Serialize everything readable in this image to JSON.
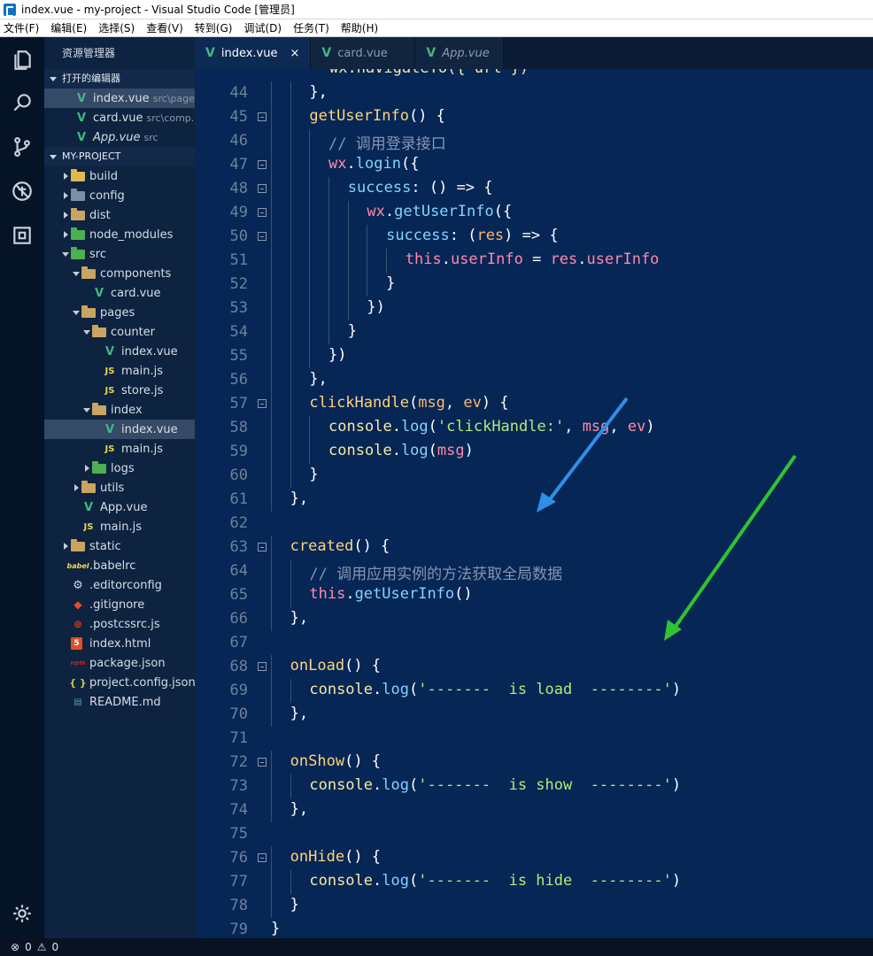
{
  "window": {
    "title": "index.vue - my-project - Visual Studio Code [管理员]"
  },
  "menu": [
    "文件(F)",
    "编辑(E)",
    "选择(S)",
    "查看(V)",
    "转到(G)",
    "调试(D)",
    "任务(T)",
    "帮助(H)"
  ],
  "activity": [
    "explorer-icon",
    "search-icon",
    "source-control-icon",
    "debug-icon",
    "extensions-icon",
    "settings-gear-icon"
  ],
  "sidebar": {
    "header": "资源管理器",
    "open_editors_label": "打开的编辑器",
    "open_editors": [
      {
        "name": "index.vue",
        "path": "src\\page...",
        "icon": "vue"
      },
      {
        "name": "card.vue",
        "path": "src\\comp...",
        "icon": "vue"
      },
      {
        "name": "App.vue",
        "path": "src",
        "icon": "vue"
      }
    ],
    "project_label": "MY-PROJECT",
    "tree": [
      {
        "name": "build",
        "depth": 0,
        "type": "folder",
        "icon": "folder-build",
        "open": false
      },
      {
        "name": "config",
        "depth": 0,
        "type": "folder",
        "icon": "folder-config",
        "open": false
      },
      {
        "name": "dist",
        "depth": 0,
        "type": "folder",
        "icon": "folder",
        "open": false
      },
      {
        "name": "node_modules",
        "depth": 0,
        "type": "folder",
        "icon": "folder-green",
        "open": false
      },
      {
        "name": "src",
        "depth": 0,
        "type": "folder",
        "icon": "folder-green",
        "open": true
      },
      {
        "name": "components",
        "depth": 1,
        "type": "folder",
        "icon": "folder",
        "open": true
      },
      {
        "name": "card.vue",
        "depth": 2,
        "type": "file",
        "icon": "vue"
      },
      {
        "name": "pages",
        "depth": 1,
        "type": "folder",
        "icon": "folder",
        "open": true
      },
      {
        "name": "counter",
        "depth": 2,
        "type": "folder",
        "icon": "folder",
        "open": true
      },
      {
        "name": "index.vue",
        "depth": 3,
        "type": "file",
        "icon": "vue"
      },
      {
        "name": "main.js",
        "depth": 3,
        "type": "file",
        "icon": "js"
      },
      {
        "name": "store.js",
        "depth": 3,
        "type": "file",
        "icon": "js"
      },
      {
        "name": "index",
        "depth": 2,
        "type": "folder",
        "icon": "folder",
        "open": true
      },
      {
        "name": "index.vue",
        "depth": 3,
        "type": "file",
        "icon": "vue",
        "selected": true
      },
      {
        "name": "main.js",
        "depth": 3,
        "type": "file",
        "icon": "js"
      },
      {
        "name": "logs",
        "depth": 2,
        "type": "folder",
        "icon": "folder-green",
        "open": false
      },
      {
        "name": "utils",
        "depth": 1,
        "type": "folder",
        "icon": "folder",
        "open": false
      },
      {
        "name": "App.vue",
        "depth": 1,
        "type": "file",
        "icon": "vue"
      },
      {
        "name": "main.js",
        "depth": 1,
        "type": "file",
        "icon": "js"
      },
      {
        "name": "static",
        "depth": 0,
        "type": "folder",
        "icon": "folder",
        "open": false
      },
      {
        "name": ".babelrc",
        "depth": 0,
        "type": "file",
        "icon": "babel"
      },
      {
        "name": ".editorconfig",
        "depth": 0,
        "type": "file",
        "icon": "gear"
      },
      {
        "name": ".gitignore",
        "depth": 0,
        "type": "file",
        "icon": "git"
      },
      {
        "name": ".postcssrc.js",
        "depth": 0,
        "type": "file",
        "icon": "post"
      },
      {
        "name": "index.html",
        "depth": 0,
        "type": "file",
        "icon": "html5"
      },
      {
        "name": "package.json",
        "depth": 0,
        "type": "file",
        "icon": "npm"
      },
      {
        "name": "project.config.json",
        "depth": 0,
        "type": "file",
        "icon": "json"
      },
      {
        "name": "README.md",
        "depth": 0,
        "type": "file",
        "icon": "md"
      }
    ]
  },
  "tabs": [
    {
      "label": "index.vue",
      "active": true,
      "close": "×"
    },
    {
      "label": "card.vue",
      "active": false
    },
    {
      "label": "App.vue",
      "active": false,
      "italic": true
    }
  ],
  "editor": {
    "partial_top_line": "wx.navigateTo({ url })",
    "lines": [
      {
        "n": 44,
        "indent": 2,
        "tokens": [
          [
            "},",
            "pun"
          ]
        ]
      },
      {
        "n": 45,
        "indent": 2,
        "fold": true,
        "tokens": [
          [
            "getUserInfo",
            "prop"
          ],
          [
            "() {",
            "pun"
          ]
        ]
      },
      {
        "n": 46,
        "indent": 3,
        "tokens": [
          [
            "// 调用登录接口",
            "cmt"
          ]
        ]
      },
      {
        "n": 47,
        "indent": 3,
        "fold": true,
        "tokens": [
          [
            "wx",
            "this"
          ],
          [
            ".",
            "pun"
          ],
          [
            "login",
            "fn"
          ],
          [
            "({",
            "pun"
          ]
        ]
      },
      {
        "n": 48,
        "indent": 4,
        "fold": true,
        "tokens": [
          [
            "success",
            "fn"
          ],
          [
            ": () ",
            "pun"
          ],
          [
            "=>",
            "arr"
          ],
          [
            " {",
            "pun"
          ]
        ]
      },
      {
        "n": 49,
        "indent": 5,
        "fold": true,
        "tokens": [
          [
            "wx",
            "this"
          ],
          [
            ".",
            "pun"
          ],
          [
            "getUserInfo",
            "fn"
          ],
          [
            "({",
            "pun"
          ]
        ]
      },
      {
        "n": 50,
        "indent": 6,
        "fold": true,
        "tokens": [
          [
            "success",
            "fn"
          ],
          [
            ": (",
            "pun"
          ],
          [
            "res",
            "par"
          ],
          [
            ") ",
            "pun"
          ],
          [
            "=>",
            "arr"
          ],
          [
            " {",
            "pun"
          ]
        ]
      },
      {
        "n": 51,
        "indent": 7,
        "tokens": [
          [
            "this",
            "this"
          ],
          [
            ".",
            "pun"
          ],
          [
            "userInfo",
            "this"
          ],
          [
            " = ",
            "pun"
          ],
          [
            "res",
            "this"
          ],
          [
            ".",
            "pun"
          ],
          [
            "userInfo",
            "this"
          ]
        ]
      },
      {
        "n": 52,
        "indent": 6,
        "tokens": [
          [
            "}",
            "pun"
          ]
        ]
      },
      {
        "n": 53,
        "indent": 5,
        "tokens": [
          [
            "})",
            "pun"
          ]
        ]
      },
      {
        "n": 54,
        "indent": 4,
        "tokens": [
          [
            "}",
            "pun"
          ]
        ]
      },
      {
        "n": 55,
        "indent": 3,
        "tokens": [
          [
            "})",
            "pun"
          ]
        ]
      },
      {
        "n": 56,
        "indent": 2,
        "tokens": [
          [
            "},",
            "pun"
          ]
        ]
      },
      {
        "n": 57,
        "indent": 2,
        "fold": true,
        "tokens": [
          [
            "clickHandle",
            "prop"
          ],
          [
            "(",
            "pun"
          ],
          [
            "msg",
            "par"
          ],
          [
            ", ",
            "pun"
          ],
          [
            "ev",
            "par"
          ],
          [
            ") {",
            "pun"
          ]
        ]
      },
      {
        "n": 58,
        "indent": 3,
        "tokens": [
          [
            "console",
            "var"
          ],
          [
            ".",
            "pun"
          ],
          [
            "log",
            "fn"
          ],
          [
            "(",
            "pun"
          ],
          [
            "'clickHandle:'",
            "str"
          ],
          [
            ", ",
            "pun"
          ],
          [
            "msg",
            "this"
          ],
          [
            ", ",
            "pun"
          ],
          [
            "ev",
            "this"
          ],
          [
            ")",
            "pun"
          ]
        ]
      },
      {
        "n": 59,
        "indent": 3,
        "tokens": [
          [
            "console",
            "var"
          ],
          [
            ".",
            "pun"
          ],
          [
            "log",
            "fn"
          ],
          [
            "(",
            "pun"
          ],
          [
            "msg",
            "this"
          ],
          [
            ")",
            "pun"
          ]
        ]
      },
      {
        "n": 60,
        "indent": 2,
        "tokens": [
          [
            "}",
            "pun"
          ]
        ]
      },
      {
        "n": 61,
        "indent": 1,
        "tokens": [
          [
            "},",
            "pun"
          ]
        ]
      },
      {
        "n": 62,
        "indent": 0,
        "tokens": []
      },
      {
        "n": 63,
        "indent": 1,
        "fold": true,
        "tokens": [
          [
            "created",
            "prop"
          ],
          [
            "() {",
            "pun"
          ]
        ]
      },
      {
        "n": 64,
        "indent": 2,
        "tokens": [
          [
            "// 调用应用实例的方法获取全局数据",
            "cmt"
          ]
        ]
      },
      {
        "n": 65,
        "indent": 2,
        "tokens": [
          [
            "this",
            "this"
          ],
          [
            ".",
            "pun"
          ],
          [
            "getUserInfo",
            "fn"
          ],
          [
            "()",
            "pun"
          ]
        ]
      },
      {
        "n": 66,
        "indent": 1,
        "tokens": [
          [
            "},",
            "pun"
          ]
        ]
      },
      {
        "n": 67,
        "indent": 0,
        "tokens": []
      },
      {
        "n": 68,
        "indent": 1,
        "fold": true,
        "tokens": [
          [
            "onLoad",
            "prop"
          ],
          [
            "() {",
            "pun"
          ]
        ]
      },
      {
        "n": 69,
        "indent": 2,
        "tokens": [
          [
            "console",
            "var"
          ],
          [
            ".",
            "pun"
          ],
          [
            "log",
            "fn"
          ],
          [
            "(",
            "pun"
          ],
          [
            "'-------  is load  --------'",
            "str"
          ],
          [
            ")",
            "pun"
          ]
        ]
      },
      {
        "n": 70,
        "indent": 1,
        "tokens": [
          [
            "},",
            "pun"
          ]
        ]
      },
      {
        "n": 71,
        "indent": 0,
        "tokens": []
      },
      {
        "n": 72,
        "indent": 1,
        "fold": true,
        "tokens": [
          [
            "onShow",
            "prop"
          ],
          [
            "() {",
            "pun"
          ]
        ]
      },
      {
        "n": 73,
        "indent": 2,
        "tokens": [
          [
            "console",
            "var"
          ],
          [
            ".",
            "pun"
          ],
          [
            "log",
            "fn"
          ],
          [
            "(",
            "pun"
          ],
          [
            "'-------  is show  --------'",
            "str"
          ],
          [
            ")",
            "pun"
          ]
        ]
      },
      {
        "n": 74,
        "indent": 1,
        "tokens": [
          [
            "},",
            "pun"
          ]
        ]
      },
      {
        "n": 75,
        "indent": 0,
        "tokens": []
      },
      {
        "n": 76,
        "indent": 1,
        "fold": true,
        "tokens": [
          [
            "onHide",
            "prop"
          ],
          [
            "() {",
            "pun"
          ]
        ]
      },
      {
        "n": 77,
        "indent": 2,
        "tokens": [
          [
            "console",
            "var"
          ],
          [
            ".",
            "pun"
          ],
          [
            "log",
            "fn"
          ],
          [
            "(",
            "pun"
          ],
          [
            "'-------  is hide  --------'",
            "str"
          ],
          [
            ")",
            "pun"
          ]
        ]
      },
      {
        "n": 78,
        "indent": 1,
        "tokens": [
          [
            "}",
            "pun"
          ]
        ]
      },
      {
        "n": 79,
        "indent": 0,
        "tokens": [
          [
            "}",
            "pun"
          ]
        ]
      }
    ]
  },
  "annotations": {
    "arrow_colors": [
      "#2f8ee8",
      "#2fc42f"
    ]
  },
  "status": {
    "errors": "0",
    "warnings": "0",
    "error_icon": "error-icon",
    "warning_icon": "warning-icon"
  },
  "colors": {
    "editor_bg": "#062656",
    "sidebar_bg": "#0d2340",
    "activity_bg": "#051326",
    "vue": "#41b883",
    "js": "#e8d44d"
  }
}
